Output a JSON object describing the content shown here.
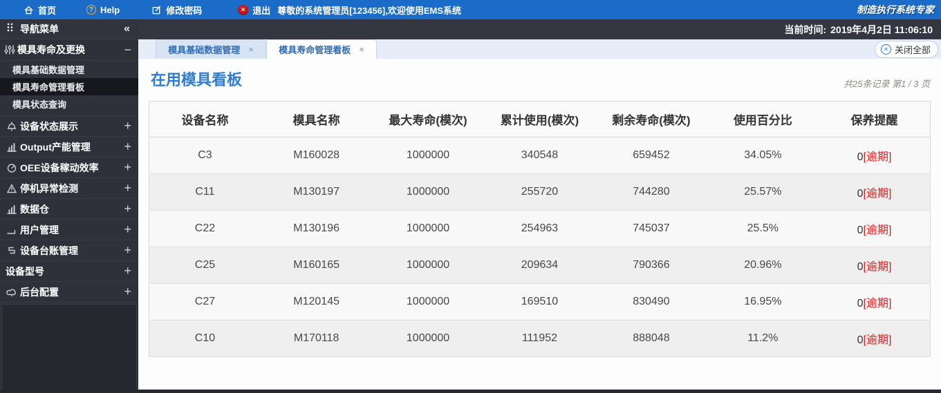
{
  "topbar": {
    "home": "首页",
    "help": "Help",
    "change_password": "修改密码",
    "logout": "退出",
    "welcome": "尊敬的系统管理员[123456],欢迎使用EMS系统",
    "brand": "制造执行系统专家"
  },
  "statusbar": {
    "current_time_label": "当前时间:",
    "current_time": "2019年4月2日 11:06:10"
  },
  "glyphs": {
    "collapse_all": "«",
    "minus": "−",
    "plus": "+",
    "tab_close": "×",
    "help_mark": "?",
    "logout_x": "✕",
    "close_all_x": "✕"
  },
  "sidebar": {
    "title": "导航菜单",
    "group": {
      "label": "模具寿命及更换",
      "items": [
        {
          "label": "模具基础数据管理"
        },
        {
          "label": "模具寿命管理看板"
        },
        {
          "label": "模具状态查询"
        }
      ]
    },
    "sections": [
      {
        "label": "设备状态展示"
      },
      {
        "label": "Output产能管理"
      },
      {
        "label": "OEE设备稼动效率"
      },
      {
        "label": "停机异常检测"
      },
      {
        "label": "数据仓"
      },
      {
        "label": "用户管理"
      },
      {
        "label": "设备台账管理"
      },
      {
        "label": "设备型号"
      },
      {
        "label": "后台配置"
      }
    ]
  },
  "tabs": {
    "items": [
      {
        "label": "模具基础数据管理"
      },
      {
        "label": "模具寿命管理看板"
      }
    ],
    "close_all": "关闭全部"
  },
  "content": {
    "title": "在用模具看板",
    "record_info": "共25条记录 第1 / 3 页"
  },
  "table": {
    "columns": [
      "设备名称",
      "模具名称",
      "最大寿命(模次)",
      "累计使用(模次)",
      "剩余寿命(模次)",
      "使用百分比",
      "保养提醒"
    ],
    "rows": [
      {
        "device": "C3",
        "mold": "M160028",
        "max_life": "1000000",
        "used": "340548",
        "remaining": "659452",
        "percent": "34.05%",
        "maintain_count": "0",
        "maintain_tag": "[逾期]"
      },
      {
        "device": "C11",
        "mold": "M130197",
        "max_life": "1000000",
        "used": "255720",
        "remaining": "744280",
        "percent": "25.57%",
        "maintain_count": "0",
        "maintain_tag": "[逾期]"
      },
      {
        "device": "C22",
        "mold": "M130196",
        "max_life": "1000000",
        "used": "254963",
        "remaining": "745037",
        "percent": "25.5%",
        "maintain_count": "0",
        "maintain_tag": "[逾期]"
      },
      {
        "device": "C25",
        "mold": "M160165",
        "max_life": "1000000",
        "used": "209634",
        "remaining": "790366",
        "percent": "20.96%",
        "maintain_count": "0",
        "maintain_tag": "[逾期]"
      },
      {
        "device": "C27",
        "mold": "M120145",
        "max_life": "1000000",
        "used": "169510",
        "remaining": "830490",
        "percent": "16.95%",
        "maintain_count": "0",
        "maintain_tag": "[逾期]"
      },
      {
        "device": "C10",
        "mold": "M170118",
        "max_life": "1000000",
        "used": "111952",
        "remaining": "888048",
        "percent": "11.2%",
        "maintain_count": "0",
        "maintain_tag": "[逾期]"
      }
    ]
  },
  "colors": {
    "topbar_blue": "#1b6cc8",
    "title_blue": "#2e7cd4",
    "alert_red": "#e81b1b",
    "sidebar_dark": "#2e313a"
  }
}
